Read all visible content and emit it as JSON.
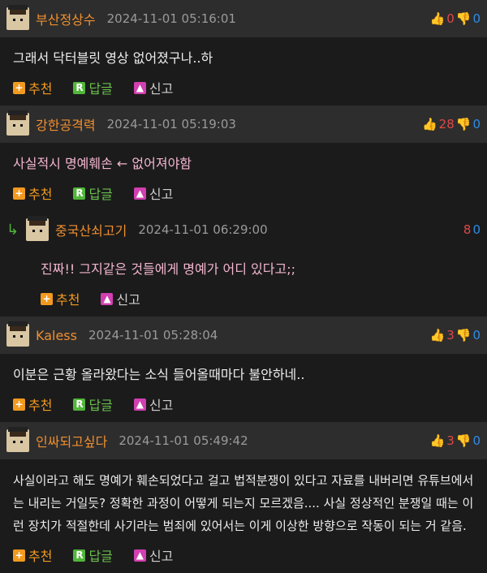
{
  "actions": {
    "recommend": "추천",
    "reply": "답글",
    "report": "신고"
  },
  "comments": [
    {
      "nick": "부산정상수",
      "date": "2024-11-01 05:16:01",
      "up": "0",
      "down": "0",
      "text": "그래서 닥터블릿 영상 없어졌구나..하"
    },
    {
      "nick": "강한공격력",
      "date": "2024-11-01 05:19:03",
      "up": "28",
      "down": "0",
      "text": "사실적시 명예훼손 ← 없어져야함"
    },
    {
      "nick": "중국산쇠고기",
      "date": "2024-11-01 06:29:00",
      "score": "8",
      "down": "0",
      "text": "진짜!! 그지같은 것들에게 명예가 어디 있다고;;"
    },
    {
      "nick": "Kaless",
      "date": "2024-11-01 05:28:04",
      "up": "3",
      "down": "0",
      "text": "이분은 근황 올라왔다는 소식 들어올때마다 불안하네.."
    },
    {
      "nick": "인싸되고싶다",
      "date": "2024-11-01 05:49:42",
      "up": "3",
      "down": "0",
      "text": "사실이라고 해도 명예가 훼손되었다고 걸고 법적분쟁이 있다고 자료를 내버리면 유튜브에서는 내리는 거일듯? 정확한 과정이 어떻게 되는지 모르겠음.... 사실 정상적인 분쟁일 때는 이런 장치가 적절한데 사기라는 범죄에 있어서는 이게 이상한 방향으로 작동이 되는 거 같음."
    }
  ]
}
